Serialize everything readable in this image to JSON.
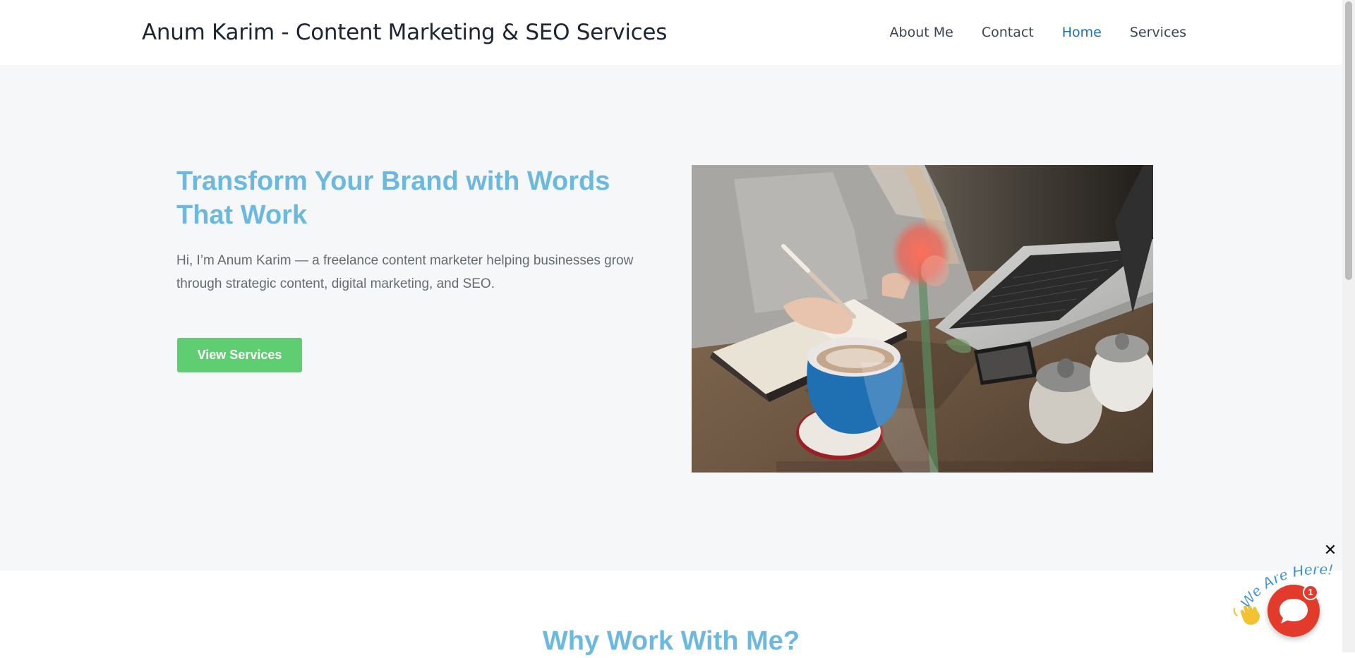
{
  "header": {
    "site_title": "Anum Karim - Content Marketing & SEO Services",
    "nav": [
      {
        "label": "About Me",
        "active": false
      },
      {
        "label": "Contact",
        "active": false
      },
      {
        "label": "Home",
        "active": true
      },
      {
        "label": "Services",
        "active": false
      }
    ]
  },
  "hero": {
    "heading": "Transform Your Brand with Words That Work",
    "intro": "Hi, I’m Anum Karim — a freelance content marketer helping businesses grow through strategic content, digital marketing, and SEO.",
    "cta_label": "View Services",
    "image": "hero-photo-writing-notebook-laptop-coffee"
  },
  "why_section": {
    "heading": "Why Work With Me?"
  },
  "chat_widget": {
    "tagline": "We Are Here!",
    "badge_count": "1",
    "close_symbol": "✕",
    "icons": [
      "close-icon",
      "wave-hand-icon",
      "chat-bubble-icon"
    ]
  },
  "colors": {
    "accent_blue": "#6cb8df",
    "nav_active": "#1f6fb0",
    "cta_green": "#5fcd71",
    "hero_bg": "#f6f7f9",
    "chat_red": "#e33b2b"
  }
}
